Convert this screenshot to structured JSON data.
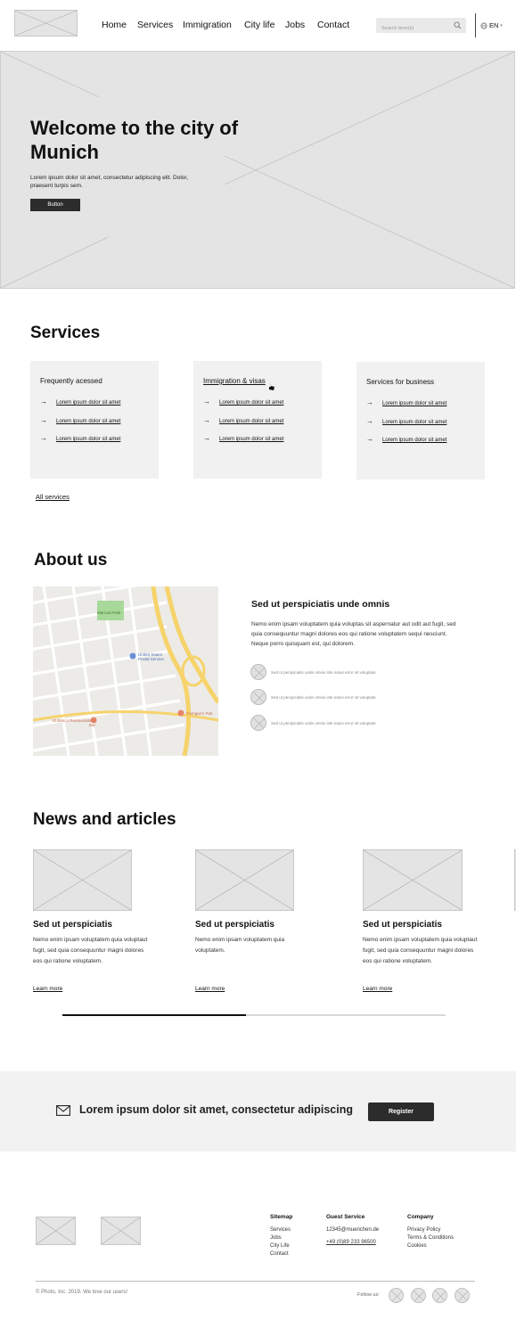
{
  "header": {
    "nav": [
      "Home",
      "Services",
      "Immigration",
      "City life",
      "Jobs",
      "Contact"
    ],
    "search_placeholder": "Search term(s)",
    "language": "EN"
  },
  "hero": {
    "title": "Welcome to the city of Munich",
    "text": "Lorem ipsum dolor sit amet, consectetur adipiscing elit. Dolor, praesent turpis sem.",
    "button": "Button"
  },
  "services": {
    "heading": "Services",
    "cards": [
      {
        "title": "Frequently acessed",
        "links": [
          "Lorem ipsum dolor sit amet",
          "Lorem ipsum dolor sit amet",
          "Lorem ipsum dolor sit amet"
        ]
      },
      {
        "title": "Immigration & visas",
        "links": [
          "Lorem ipsum dolor sit amet",
          "Lorem ipsum dolor sit amet",
          "Lorem ipsum dolor sit amet"
        ]
      },
      {
        "title": "Services for business",
        "links": [
          "Lorem ipsum dolor sit amet",
          "Lorem ipsum dolor sit amet",
          "Lorem ipsum dolor sit amet"
        ]
      }
    ],
    "all_link": "All services"
  },
  "about": {
    "heading": "About us",
    "title": "Sed ut perspiciatis unde omnis",
    "text": "Nemo enim ipsam voluptatem quia voluptas sit aspernatur aut odit aut fugit, sed quia consequuntur magni dolores eos qui ratione voluptatem sequi nesciunt. Neque porro quisquam est, qui dolorem.",
    "features": [
      "Sed ut perspiciatis unde omnis iste natus error sit voluptate",
      "Sed ut perspiciatis unde omnis iste natus error sit voluptate",
      "Sed ut perspiciatis unde omnis iste natus error sit voluptate"
    ],
    "map_labels": {
      "park": "Marconi Park",
      "postal": "United States Postal Service",
      "restaurant": "El Banco Restaurante Y Bar",
      "store": "Carrigan's Pub"
    }
  },
  "news": {
    "heading": "News and articles",
    "items": [
      {
        "title": "Sed ut perspiciatis",
        "text": "Nemo enim ipsam voluptatem quia voluptaut fugit, sed quia consequuntur magni dolores eos qui ratione voluptatem.",
        "link": "Learn more"
      },
      {
        "title": "Sed ut perspiciatis",
        "text": "Nemo enim ipsam voluptatem quia voluptatem.",
        "link": "Learn more"
      },
      {
        "title": "Sed ut perspiciatis",
        "text": "Nemo enim ipsam voluptatem quia voluptaut fugit, sed quia consequuntur magni dolores eos qui ratione voluptatem.",
        "link": "Learn more"
      }
    ],
    "carousel_progress": 0.48
  },
  "register": {
    "text": "Lorem ipsum dolor sit amet, consectetur adipiscing",
    "button": "Register"
  },
  "footer": {
    "sitemap": {
      "heading": "Sitemap",
      "items": [
        "Services",
        "Jobs",
        "City Life",
        "Contact"
      ]
    },
    "guest": {
      "heading": "Guest Service",
      "email": "12345@muenchen.de",
      "phone": "+49 (0)89 233 96500"
    },
    "company": {
      "heading": "Company",
      "items": [
        "Privacy Policy",
        "Terms & Conditions",
        "Cookies"
      ]
    },
    "copyright": "© Photo, Inc. 2019. We love our users!",
    "follow": "Follow us:"
  },
  "colors": {
    "dark_button": "#2c2c2c",
    "placeholder": "#e4e4e4",
    "card_bg": "#f1f1f1",
    "map_road": "#f6d36b"
  }
}
